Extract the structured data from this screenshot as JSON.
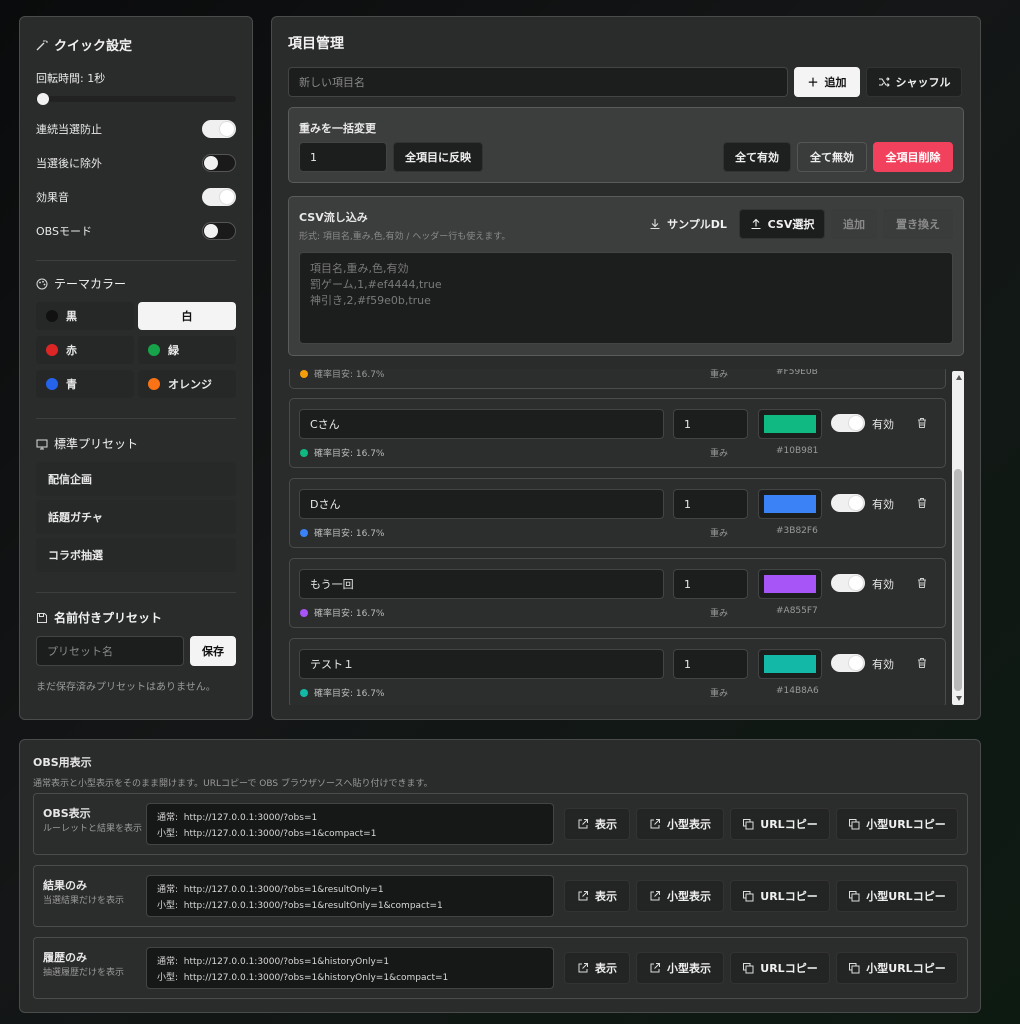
{
  "quick": {
    "title": "クイック設定",
    "spin_label": "回転時間: 1秒",
    "spin_value": 0,
    "toggles": [
      {
        "label": "連続当選防止",
        "on": true
      },
      {
        "label": "当選後に除外",
        "on": false
      },
      {
        "label": "効果音",
        "on": true
      },
      {
        "label": "OBSモード",
        "on": false
      }
    ],
    "theme_title": "テーマカラー",
    "themes": [
      {
        "label": "黒",
        "color": "#111111",
        "selected": false
      },
      {
        "label": "白",
        "color": "#ffffff",
        "selected": true
      },
      {
        "label": "赤",
        "color": "#dc2626",
        "selected": false
      },
      {
        "label": "緑",
        "color": "#16a34a",
        "selected": false
      },
      {
        "label": "青",
        "color": "#2563eb",
        "selected": false
      },
      {
        "label": "オレンジ",
        "color": "#f97316",
        "selected": false
      }
    ],
    "preset_title": "標準プリセット",
    "presets": [
      "配信企画",
      "話題ガチャ",
      "コラボ抽選"
    ],
    "named_title": "名前付きプリセット",
    "named_placeholder": "プリセット名",
    "save_label": "保存",
    "empty_text": "まだ保存済みプリセットはありません。"
  },
  "items": {
    "title": "項目管理",
    "new_placeholder": "新しい項目名",
    "add_label": "追加",
    "shuffle_label": "シャッフル",
    "weight_title": "重みを一括変更",
    "weight_value": "1",
    "apply_label": "全項目に反映",
    "enable_all": "全て有効",
    "disable_all": "全て無効",
    "delete_all": "全項目削除",
    "csv_title": "CSV流し込み",
    "csv_hint": "形式: 項目名,重み,色,有効 / ヘッダー行も使えます。",
    "sample_label": "サンプルDL",
    "csv_select": "CSV選択",
    "csv_add": "追加",
    "csv_replace": "置き換え",
    "csv_placeholder_lines": [
      "項目名,重み,色,有効",
      "罰ゲーム,1,#ef4444,true",
      "神引き,2,#f59e0b,true"
    ],
    "partial": {
      "prob": "確率目安: 16.7%",
      "weight_caption": "重み",
      "hex": "#F59E0B",
      "color": "#F59E0B"
    },
    "list": [
      {
        "name": "Cさん",
        "weight": "1",
        "color": "#10B981",
        "hex": "#10B981",
        "status": "有効",
        "prob": "確率目安: 16.7%",
        "weight_caption": "重み"
      },
      {
        "name": "Dさん",
        "weight": "1",
        "color": "#3B82F6",
        "hex": "#3B82F6",
        "status": "有効",
        "prob": "確率目安: 16.7%",
        "weight_caption": "重み"
      },
      {
        "name": "もう一回",
        "weight": "1",
        "color": "#A855F7",
        "hex": "#A855F7",
        "status": "有効",
        "prob": "確率目安: 16.7%",
        "weight_caption": "重み"
      },
      {
        "name": "テスト１",
        "weight": "1",
        "color": "#14B8A6",
        "hex": "#14B8A6",
        "status": "有効",
        "prob": "確率目安: 16.7%",
        "weight_caption": "重み"
      }
    ]
  },
  "obs": {
    "title": "OBS用表示",
    "description": "通常表示と小型表示をそのまま開けます。URLコピーで OBS ブラウザソースへ貼り付けできます。",
    "normal_prefix": "通常:",
    "compact_prefix": "小型:",
    "btn_show": "表示",
    "btn_compact": "小型表示",
    "btn_copy": "URLコピー",
    "btn_copy_compact": "小型URLコピー",
    "rows": [
      {
        "title": "OBS表示",
        "desc": "ルーレットと結果を表示",
        "normal": "http://127.0.0.1:3000/?obs=1",
        "compact": "http://127.0.0.1:3000/?obs=1&compact=1"
      },
      {
        "title": "結果のみ",
        "desc": "当選結果だけを表示",
        "normal": "http://127.0.0.1:3000/?obs=1&resultOnly=1",
        "compact": "http://127.0.0.1:3000/?obs=1&resultOnly=1&compact=1"
      },
      {
        "title": "履歴のみ",
        "desc": "抽選履歴だけを表示",
        "normal": "http://127.0.0.1:3000/?obs=1&historyOnly=1",
        "compact": "http://127.0.0.1:3000/?obs=1&historyOnly=1&compact=1"
      }
    ]
  }
}
